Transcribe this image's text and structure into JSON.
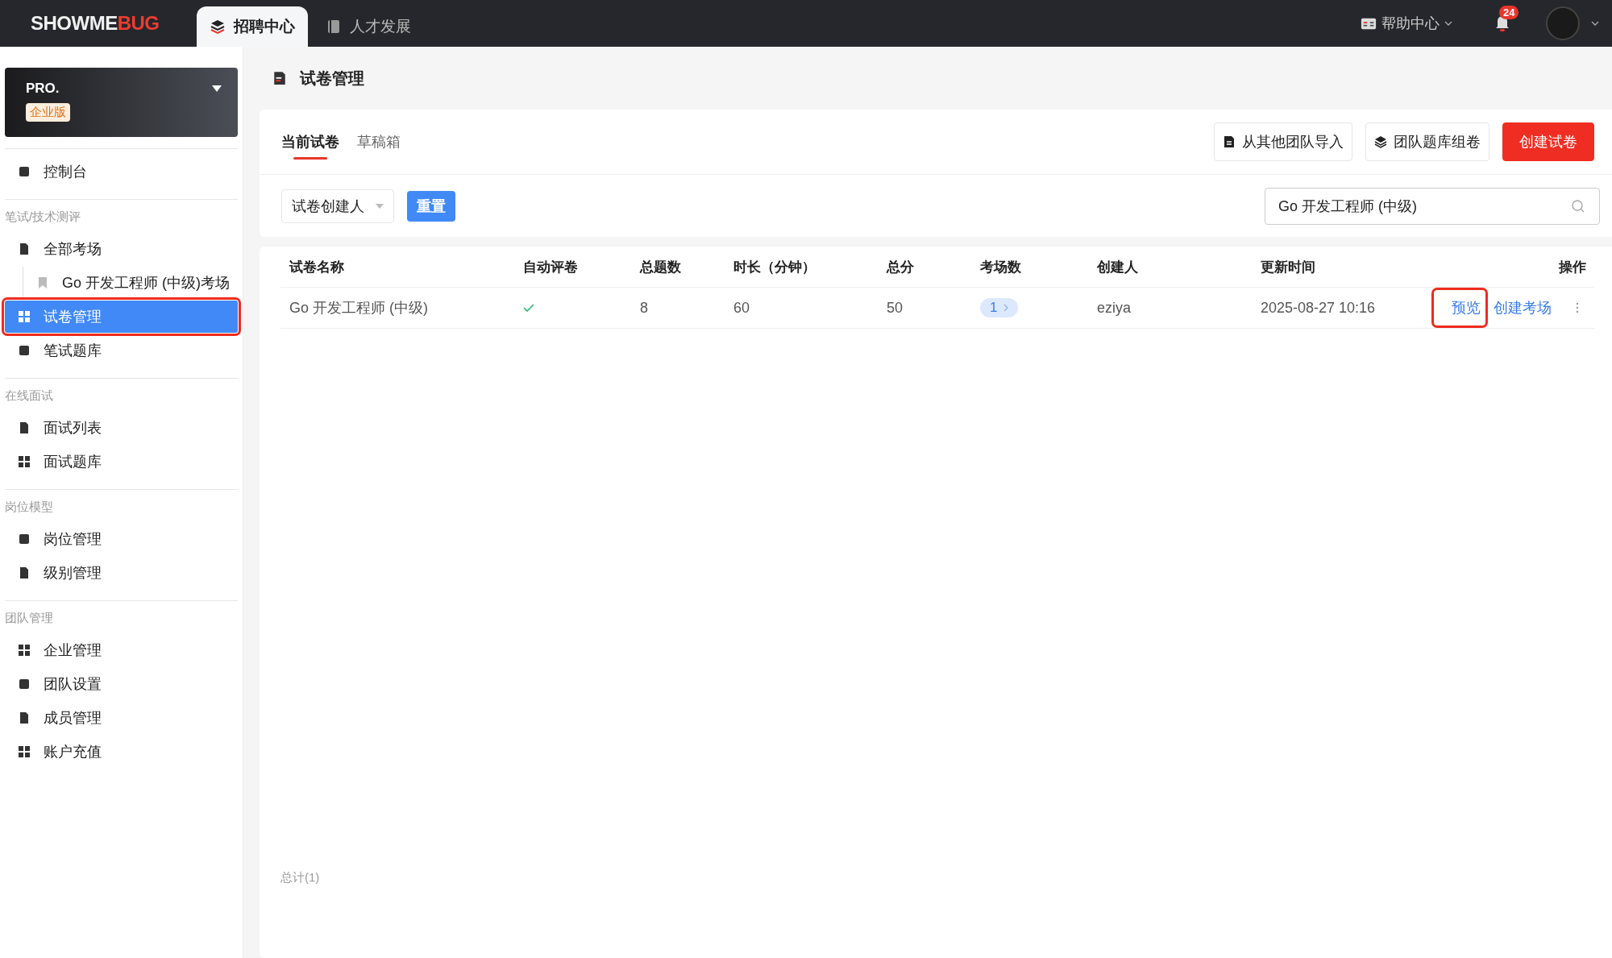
{
  "topbar": {
    "logo": {
      "main": "SHOWME",
      "accent": "BUG"
    },
    "tabs": [
      {
        "label": "招聘中心",
        "selected": true
      },
      {
        "label": "人才发展",
        "selected": false
      }
    ],
    "help": "帮助中心",
    "notification_count": "24"
  },
  "sidebar": {
    "plan": {
      "name": "PRO.",
      "edition": "企业版"
    },
    "sections": [
      {
        "items": [
          {
            "label": "控制台",
            "selected": false,
            "annotated": false
          }
        ]
      },
      {
        "title": "笔试/技术测评",
        "items": [
          {
            "label": "全部考场",
            "selected": false,
            "annotated": false,
            "children": [
              {
                "label": "Go 开发工程师 (中级)考场",
                "selected": false,
                "annotated": false
              }
            ]
          },
          {
            "label": "试卷管理",
            "selected": true,
            "annotated": true
          },
          {
            "label": "笔试题库",
            "selected": false,
            "annotated": false
          }
        ]
      },
      {
        "title": "在线面试",
        "items": [
          {
            "label": "面试列表",
            "selected": false,
            "annotated": false
          },
          {
            "label": "面试题库",
            "selected": false,
            "annotated": false
          }
        ]
      },
      {
        "title": "岗位模型",
        "items": [
          {
            "label": "岗位管理",
            "selected": false,
            "annotated": false
          },
          {
            "label": "级别管理",
            "selected": false,
            "annotated": false
          }
        ]
      },
      {
        "title": "团队管理",
        "items": [
          {
            "label": "企业管理",
            "selected": false,
            "annotated": false
          },
          {
            "label": "团队设置",
            "selected": false,
            "annotated": false
          },
          {
            "label": "成员管理",
            "selected": false,
            "annotated": false
          },
          {
            "label": "账户充值",
            "selected": false,
            "annotated": false
          }
        ]
      }
    ]
  },
  "page": {
    "title": "试卷管理",
    "tabs": [
      {
        "label": "当前试卷",
        "selected": true
      },
      {
        "label": "草稿箱",
        "selected": false
      }
    ],
    "actions": [
      {
        "label": "从其他团队导入",
        "kind": "import"
      },
      {
        "label": "团队题库组卷",
        "kind": "compose"
      },
      {
        "label": "创建试卷",
        "kind": "primary"
      }
    ],
    "filter": {
      "creator_placeholder": "试卷创建人",
      "reset": "重置",
      "search_value": "Go 开发工程师 (中级)"
    },
    "table": {
      "columns": [
        "试卷名称",
        "自动评卷",
        "总题数",
        "时长（分钟）",
        "总分",
        "考场数",
        "创建人",
        "更新时间",
        "操作"
      ],
      "rows": [
        {
          "name": "Go 开发工程师 (中级)",
          "auto_grade": true,
          "questions": "8",
          "duration": "60",
          "score": "50",
          "sessions": "1",
          "creator": "eziya",
          "updated": "2025-08-27 10:16",
          "actions": [
            {
              "label": "预览",
              "annotated": true
            },
            {
              "label": "创建考场",
              "annotated": false
            }
          ]
        }
      ]
    },
    "total": "总计(1)"
  }
}
